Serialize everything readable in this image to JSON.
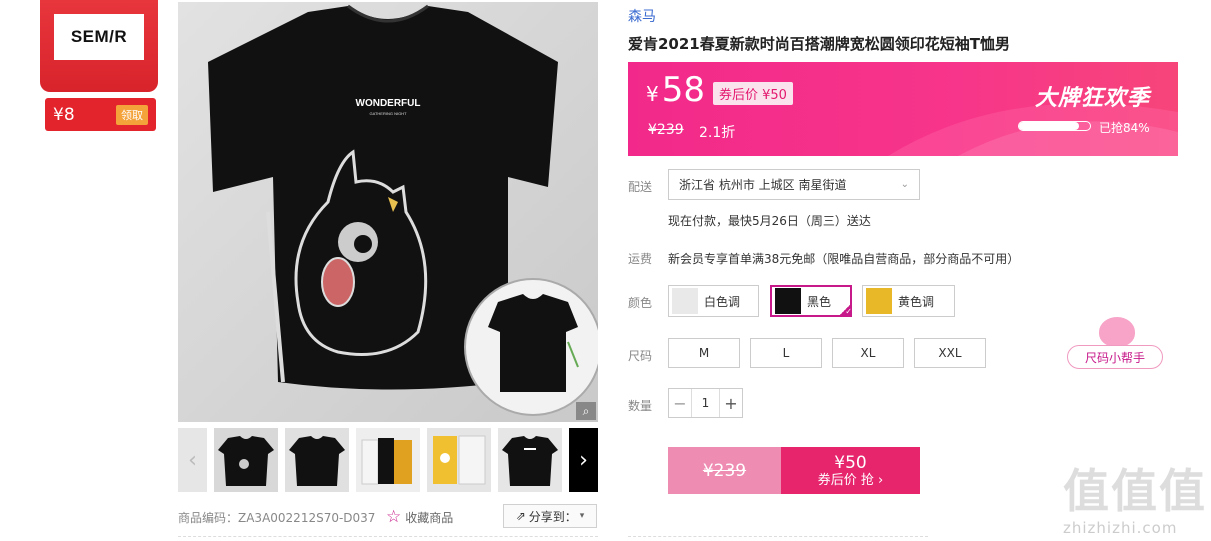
{
  "badge": {
    "logo": "SEM/R",
    "price": "¥8",
    "claim": "领取"
  },
  "product": {
    "brand": "森马",
    "title": "爱肯2021春夏新款时尚百搭潮牌宽松圆领印花短袖T恤男",
    "shirt_text_main": "WONDERFUL",
    "shirt_text_sub": "GATHERING NIGHT"
  },
  "price": {
    "currency": "¥",
    "current": "58",
    "coupon_tag": "券后价 ¥50",
    "original": "¥239",
    "discount": "2.1折",
    "promo_name": "大牌狂欢季",
    "progress_fraction": 0.84,
    "progress_text": "已抢84%"
  },
  "delivery": {
    "label": "配送",
    "address": "浙江省 杭州市 上城区 南星街道",
    "estimate": "现在付款，最快5月26日（周三）送达"
  },
  "shipping": {
    "label": "运费",
    "text": "新会员专享首单满38元免邮（限唯品自营商品，部分商品不可用）"
  },
  "colors": {
    "label": "颜色",
    "options": [
      {
        "name": "白色调",
        "swatch": "#e9e9e9"
      },
      {
        "name": "黑色",
        "swatch": "#111111"
      },
      {
        "name": "黄色调",
        "swatch": "#e8b828"
      }
    ],
    "selected": "黑色"
  },
  "sizes": {
    "label": "尺码",
    "options": [
      "M",
      "L",
      "XL",
      "XXL"
    ],
    "help": "尺码小帮手"
  },
  "quantity": {
    "label": "数量",
    "minus": "−",
    "value": "1",
    "plus": "+"
  },
  "buy": {
    "original": "¥239",
    "price": "¥50",
    "label": "券后价 抢 ›"
  },
  "meta": {
    "code": "商品编码：ZA3A002212S70-D037",
    "favorite": "收藏商品",
    "share": "分享到："
  },
  "watermark": {
    "chars": "值值值",
    "url": "zhizhizhi.com"
  },
  "colors_theme": {
    "accent": "#e6256d",
    "brand_link": "#3b6bd1",
    "badge_red": "#e3242d"
  }
}
